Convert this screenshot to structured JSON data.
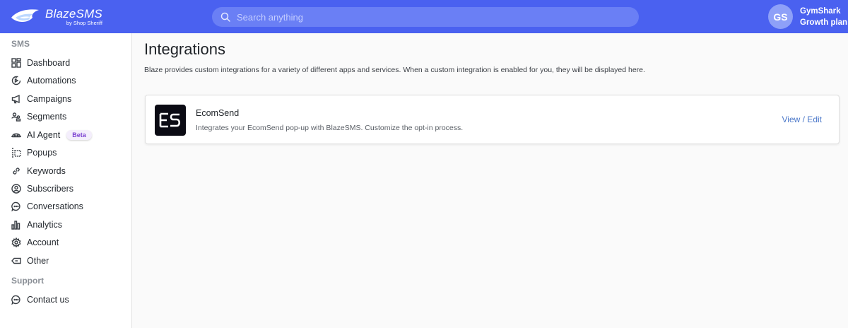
{
  "brand": {
    "title": "BlazeSMS",
    "subtitle": "by Shop Sheriff",
    "accent": "#4a61f0"
  },
  "search": {
    "placeholder": "Search anything",
    "value": ""
  },
  "account": {
    "initials": "GS",
    "name": "GymShark",
    "plan": "Growth plan"
  },
  "sidebar": {
    "sms_label": "SMS",
    "support_label": "Support",
    "items": [
      {
        "label": "Dashboard",
        "icon": "dashboard-icon"
      },
      {
        "label": "Automations",
        "icon": "automations-icon"
      },
      {
        "label": "Campaigns",
        "icon": "megaphone-icon"
      },
      {
        "label": "Segments",
        "icon": "segments-icon"
      },
      {
        "label": "AI Agent",
        "icon": "ai-agent-icon",
        "badge": "Beta"
      },
      {
        "label": "Popups",
        "icon": "popup-icon"
      },
      {
        "label": "Keywords",
        "icon": "link-icon"
      },
      {
        "label": "Subscribers",
        "icon": "user-circle-icon"
      },
      {
        "label": "Conversations",
        "icon": "chat-bubble-icon"
      },
      {
        "label": "Analytics",
        "icon": "bar-chart-icon"
      },
      {
        "label": "Account",
        "icon": "gear-icon"
      },
      {
        "label": "Other",
        "icon": "tag-icon"
      }
    ],
    "support_items": [
      {
        "label": "Contact us",
        "icon": "chat-bubble-icon"
      }
    ]
  },
  "main": {
    "title": "Integrations",
    "description": "Blaze provides custom integrations for a variety of different apps and services. When a custom integration is enabled for you, they will be displayed here.",
    "integrations": [
      {
        "name": "EcomSend",
        "description": "Integrates your EcomSend pop-up with BlazeSMS. Customize the opt-in process.",
        "action": "View / Edit"
      }
    ]
  }
}
